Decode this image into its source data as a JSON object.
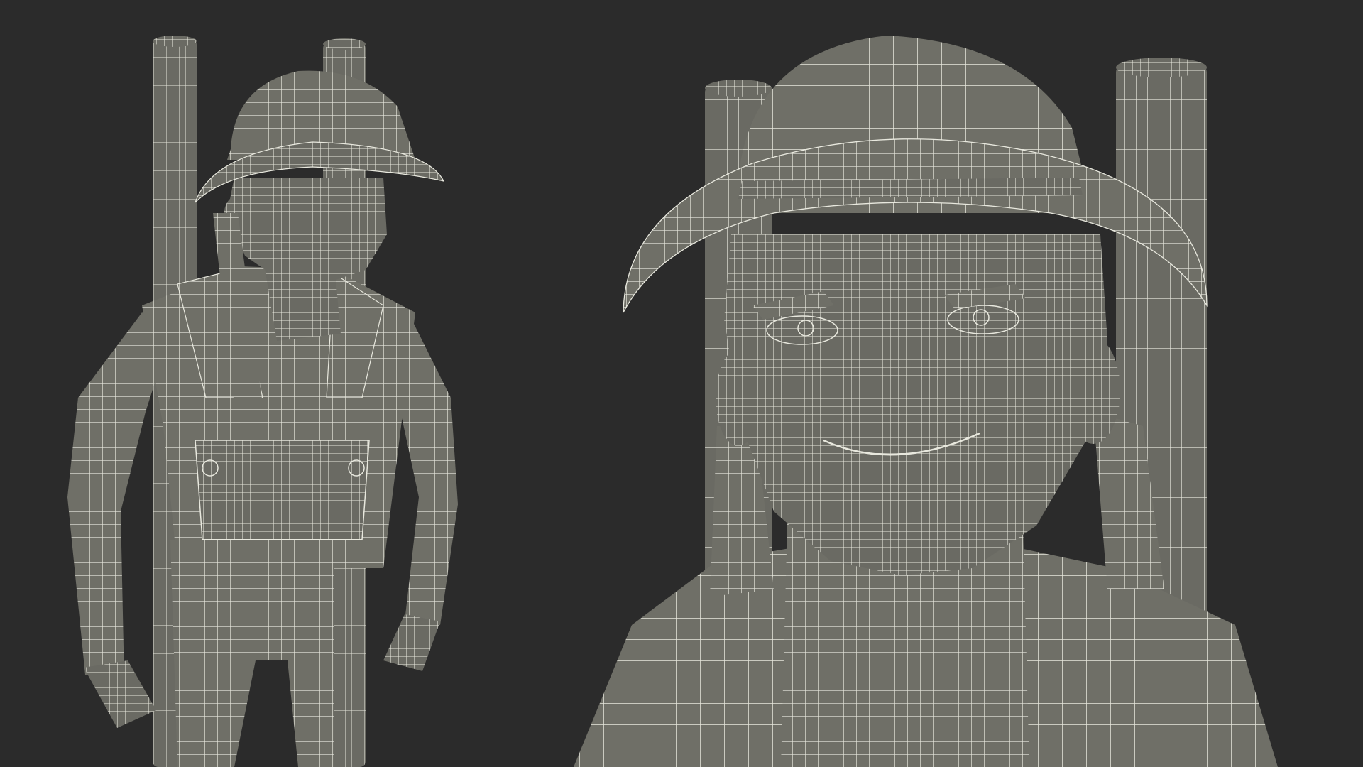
{
  "scene": {
    "background_color": "#2b2b2b",
    "model_color": "#6f6f67",
    "model_shade_color": "#5c5c55",
    "wire_color": "#e8e8de",
    "views": [
      {
        "name": "full-body-view",
        "subject": "wireframe-character-on-stilts"
      },
      {
        "name": "head-closeup-view",
        "subject": "wireframe-character-head"
      }
    ]
  }
}
